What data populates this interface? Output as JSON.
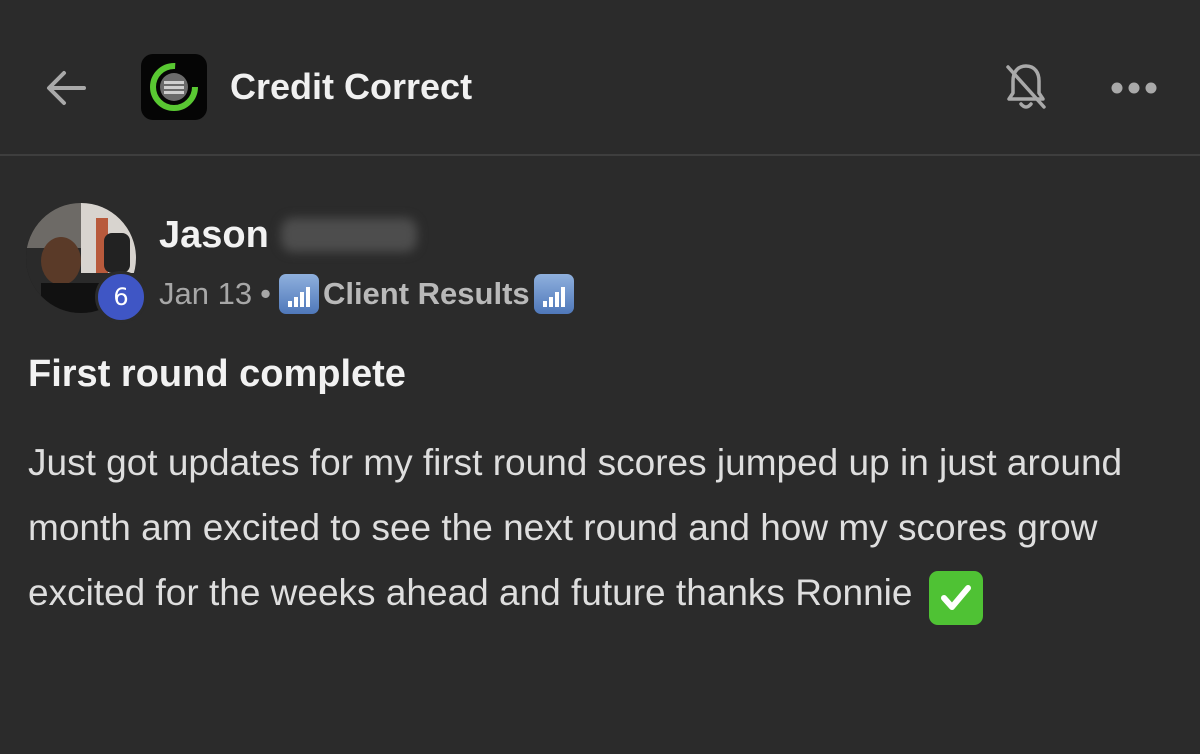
{
  "header": {
    "title": "Credit Correct",
    "back_icon": "arrow-left-icon",
    "notifications_icon": "bell-off-icon",
    "more_icon": "more-horizontal-icon",
    "logo_icon": "credit-correct-logo"
  },
  "post": {
    "author_first_name": "Jason",
    "author_level": "6",
    "date": "Jan 13",
    "separator": "•",
    "category": "Client Results",
    "category_icon": "signal-bars-icon",
    "title": "First round complete",
    "body": "Just got updates for my first round scores jumped up in just around month am excited to see the next round and how my scores grow excited for the weeks ahead and future thanks Ronnie",
    "body_emoji": "check-mark-button-icon"
  },
  "colors": {
    "background": "#2b2b2b",
    "level_badge": "#3f56c5",
    "logo_ring": "#59c832",
    "check_emoji": "#4fc234"
  }
}
